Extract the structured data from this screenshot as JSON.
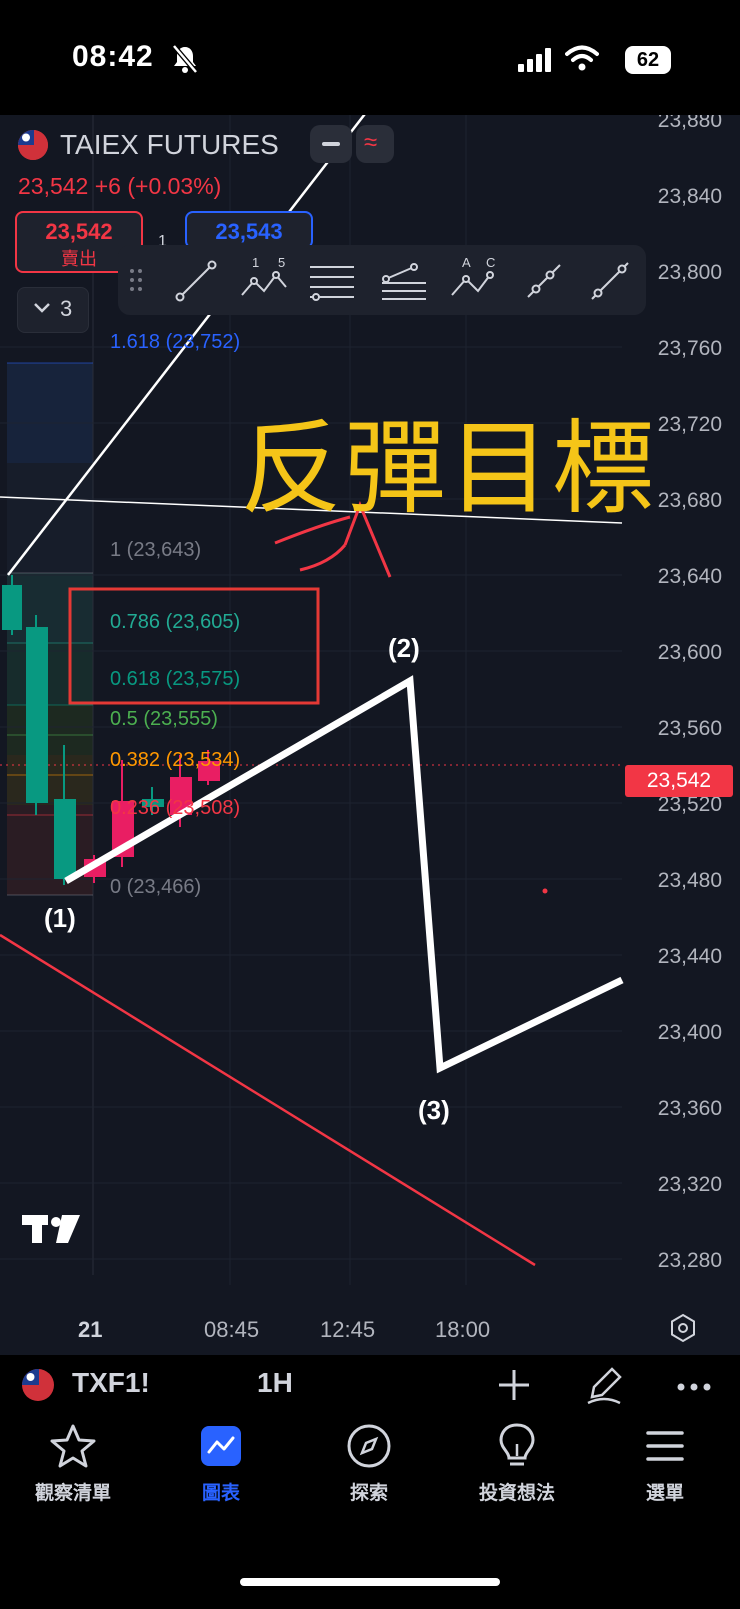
{
  "status_bar": {
    "time": "08:42",
    "battery": "62"
  },
  "header": {
    "symbol": "TAIEX FUTURES",
    "change_line": "23,542  +6 (+0.03%)",
    "sell_price": "23,542",
    "sell_label": "賣出",
    "spread": "1",
    "buy_price": "23,543",
    "indicator_count": "3"
  },
  "annotation": {
    "title": "反彈目標"
  },
  "fib_levels": {
    "l1618": "1.618 (23,752)",
    "l1": "1 (23,643)",
    "l0786": "0.786 (23,605)",
    "l0618": "0.618 (23,575)",
    "l05": "0.5 (23,555)",
    "l0382": "0.382 (23,534)",
    "l0236": "0.236 (23,508)",
    "l0": "0 (23,466)"
  },
  "wave_labels": {
    "w1": "(1)",
    "w2": "(2)",
    "w3": "(3)"
  },
  "price_axis": [
    "23,880",
    "23,840",
    "23,800",
    "23,760",
    "23,720",
    "23,680",
    "23,640",
    "23,600",
    "23,560",
    "23,520",
    "23,480",
    "23,440",
    "23,400",
    "23,360",
    "23,320",
    "23,280"
  ],
  "current_price": "23,542",
  "time_axis": {
    "t1": "21",
    "t2": "08:45",
    "t3": "12:45",
    "t4": "18:00"
  },
  "symbol_bar": {
    "ticker": "TXF1!",
    "timeframe": "1H"
  },
  "nav": {
    "watchlist": "觀察清單",
    "chart": "圖表",
    "explore": "探索",
    "ideas": "投資想法",
    "menu": "選單"
  },
  "colors": {
    "bg": "#131722",
    "red": "#f23645",
    "green": "#089981",
    "blue": "#2962ff",
    "yellow": "#f5c518"
  }
}
